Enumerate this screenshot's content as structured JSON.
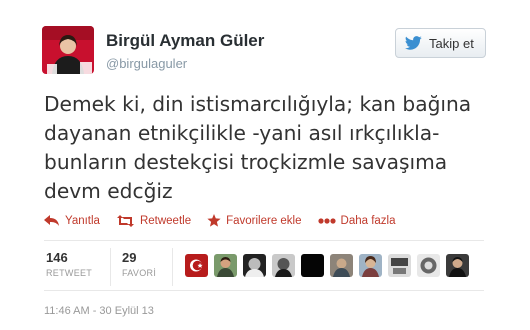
{
  "tweet": {
    "author_name": "Birgül Ayman Güler",
    "author_handle": "@birgulaguler",
    "follow_label": "Takip et",
    "text": "Demek ki, din istismarcılığıyla; kan bağına dayanan etnikçilikle -yani asıl ırkçılıkla- bunların destekçisi troçkizmle savaşıma devm edcğiz",
    "actions": {
      "reply": "Yanıtla",
      "retweet": "Retweetle",
      "favorite": "Favorilere ekle",
      "more": "Daha fazla"
    },
    "stats": {
      "retweets_count": "146",
      "retweets_label": "RETWEET",
      "favorites_count": "29",
      "favorites_label": "FAVORİ"
    },
    "timestamp": "11:46 AM - 30 Eylül 13"
  },
  "colors": {
    "accent": "#c0392b",
    "muted": "#999999",
    "avatar_bg": "#c8102e"
  },
  "icons": [
    "twitter-bird-icon",
    "reply-icon",
    "retweet-icon",
    "star-icon",
    "more-dots-icon"
  ]
}
